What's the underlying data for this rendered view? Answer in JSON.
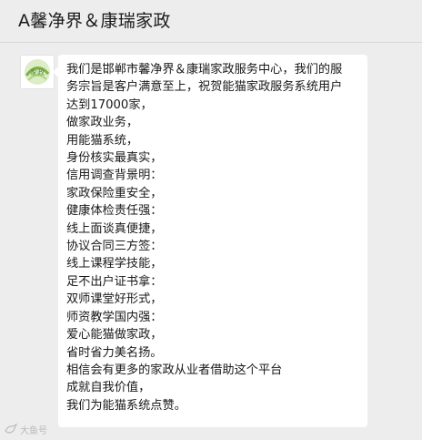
{
  "header": {
    "title": "A馨净界＆康瑞家政"
  },
  "avatar": {
    "text": "家政",
    "colors": {
      "green": "#7cb342",
      "light": "#dcedc8"
    }
  },
  "message": {
    "lines": [
      "我们是邯郸市馨净界＆康瑞家政服务中心，我们的服",
      "务宗旨是客户满意至上，祝贺能猫家政服务系统用户",
      "达到17000家，",
      "做家政业务，",
      "用能猫系统，",
      "身份核实最真实，",
      "信用调查背景明：",
      "家政保险重安全，",
      "健康体检责任强：",
      "线上面谈真便捷，",
      "协议合同三方签：",
      "线上课程学技能，",
      "足不出户证书拿：",
      "双师课堂好形式，",
      "师资教学国内强：",
      "爱心能猫做家政，",
      "省时省力美名扬。",
      "相信会有更多的家政从业者借助这个平台",
      "成就自我价值，",
      "我们为能猫系统点赞。"
    ]
  },
  "watermark": {
    "icon": "bird-logo-icon",
    "text": "大鱼号"
  }
}
